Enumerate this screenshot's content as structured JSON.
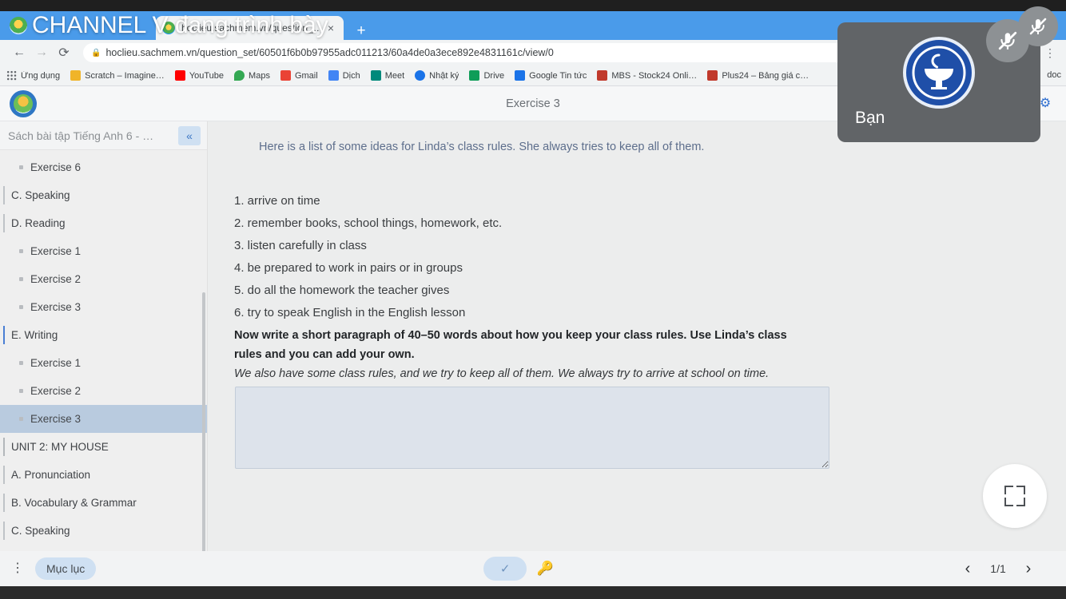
{
  "browser": {
    "tab": {
      "title": "hoclieu.sachmem.vn/question_set…",
      "favicon": "sachmem-favicon",
      "close_label": "×"
    },
    "new_tab_label": "+",
    "nav": {
      "back": "←",
      "forward": "→",
      "reload": "⟳",
      "menu": "⋮"
    },
    "url": "hoclieu.sachmem.vn/question_set/60501f6b0b97955adc011213/60a4de0a3ece892e4831161c/view/0",
    "lock_icon": "🔒",
    "bookmarks": [
      {
        "label": "Ứng dụng",
        "icon": "apps-grid-icon",
        "color": "#5f6368"
      },
      {
        "label": "Scratch – Imagine…",
        "icon": "scratch-icon",
        "color": "#f0b429"
      },
      {
        "label": "YouTube",
        "icon": "youtube-icon",
        "color": "#ff0000"
      },
      {
        "label": "Maps",
        "icon": "maps-icon",
        "color": "#34a853"
      },
      {
        "label": "Gmail",
        "icon": "gmail-icon",
        "color": "#ea4335"
      },
      {
        "label": "Dịch",
        "icon": "translate-icon",
        "color": "#4285f4"
      },
      {
        "label": "Meet",
        "icon": "meet-icon",
        "color": "#00897b"
      },
      {
        "label": "Nhật ký",
        "icon": "clock-icon",
        "color": "#1a73e8"
      },
      {
        "label": "Drive",
        "icon": "drive-icon",
        "color": "#0f9d58"
      },
      {
        "label": "Google Tin tức",
        "icon": "news-icon",
        "color": "#1a73e8"
      },
      {
        "label": "MBS - Stock24 Onli…",
        "icon": "mbs-icon",
        "color": "#c0392b"
      },
      {
        "label": "Plus24 – Bảng giá c…",
        "icon": "mbs-icon",
        "color": "#c0392b"
      }
    ],
    "overflow_bookmark": "doc"
  },
  "presenting": {
    "text": "CHANNEL V đang trình bày",
    "icon": "sachmem-favicon"
  },
  "self_tile": {
    "name": "Bạn",
    "avatar": "pharmacy-caduceus-avatar",
    "mic_icon": "mic-off-icon"
  },
  "app": {
    "title": "Exercise 3",
    "logo": "sachmem-logo",
    "settings_icon": "gear-icon"
  },
  "sidebar": {
    "title": "Sách bài tập Tiếng Anh 6 - …",
    "collapse_icon": "«",
    "items": [
      {
        "label": "Exercise 6",
        "level": 2,
        "selected": false
      },
      {
        "label": "C. Speaking",
        "level": 1,
        "selected": false
      },
      {
        "label": "D. Reading",
        "level": 1,
        "selected": false
      },
      {
        "label": "Exercise 1",
        "level": 2,
        "selected": false
      },
      {
        "label": "Exercise 2",
        "level": 2,
        "selected": false
      },
      {
        "label": "Exercise 3",
        "level": 2,
        "selected": false
      },
      {
        "label": "E. Writing",
        "level": 1,
        "selected": false,
        "accent": true
      },
      {
        "label": "Exercise 1",
        "level": 2,
        "selected": false
      },
      {
        "label": "Exercise 2",
        "level": 2,
        "selected": false
      },
      {
        "label": "Exercise 3",
        "level": 2,
        "selected": true
      },
      {
        "label": "UNIT 2: MY HOUSE",
        "level": 1,
        "selected": false,
        "unit": true
      },
      {
        "label": "A. Pronunciation",
        "level": 1,
        "selected": false
      },
      {
        "label": "B. Vocabulary & Grammar",
        "level": 1,
        "selected": false
      },
      {
        "label": "C. Speaking",
        "level": 1,
        "selected": false
      }
    ]
  },
  "exercise": {
    "intro": "Here is a list of some ideas for Linda’s class rules. She always tries to keep all of them.",
    "rules": [
      "1. arrive on time",
      "2. remember books, school things, homework, etc.",
      "3. listen carefully in class",
      "4. be prepared to work in pairs or in groups",
      "5. do all the homework the teacher gives",
      "6. try to speak English in the English lesson"
    ],
    "instruction": "Now write a short paragraph of 40–50 words about how you keep your class rules. Use Linda’s class rules and you can add your own.",
    "sample_answer": "We also have some class rules, and we try to keep all of them. We always try to arrive at school on time.",
    "answer_value": "",
    "answer_placeholder": ""
  },
  "fullscreen_button": {
    "icon": "exit-fullscreen-icon"
  },
  "toolbar": {
    "kebab_icon": "⋮",
    "toc_label": "Mục lục",
    "check_icon": "✓",
    "key_icon": "key-icon",
    "prev_icon": "‹",
    "next_icon": "›",
    "page_label": "1/1"
  },
  "colors": {
    "tab_strip": "#4a9bea",
    "accent_blue": "#2f6fd0",
    "selected_item": "#b9cbdf",
    "intro_text": "#5d6e8c",
    "answer_box": "#dde3eb"
  }
}
